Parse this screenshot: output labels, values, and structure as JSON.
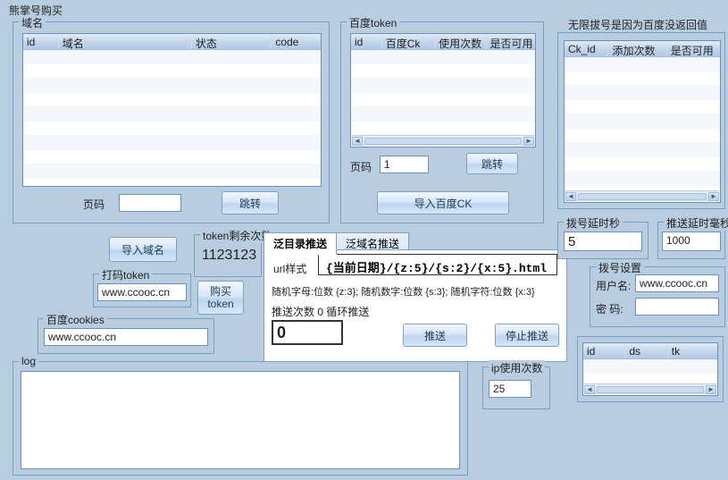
{
  "top_title": "熊掌号购买",
  "domain_group": {
    "label": "域名",
    "cols": {
      "id": "id",
      "name": "域名",
      "status": "状态",
      "code": "code"
    },
    "page_label": "页码",
    "page_value": "",
    "jump_label": "跳转"
  },
  "baidu_group": {
    "label": "百度token",
    "cols": {
      "id": "id",
      "ck": "百度Ck",
      "count": "使用次数",
      "usable": "是否可用"
    },
    "page_label": "页码",
    "page_value": "1",
    "jump_label": "跳转",
    "import_label": "导入百度CK"
  },
  "right_warning": "无限拔号是因为百度没返回值",
  "right_table": {
    "cols": {
      "ckid": "Ck_id",
      "add": "添加次数",
      "usable": "是否可用"
    }
  },
  "import_domain_btn": "导入域名",
  "remaining_token": {
    "label": "token剩余次数",
    "value": "1123123"
  },
  "buy_token_btn": "购买\ntoken",
  "dama_token": {
    "label": "打码token",
    "value": "www.ccooc.cn"
  },
  "baidu_cookies": {
    "label": "百度cookies",
    "value": "www.ccooc.cn"
  },
  "log": {
    "label": "log"
  },
  "delay_sec": {
    "label": "拨号延时秒",
    "value": "5"
  },
  "delay_ms": {
    "label": "推送延时毫秒",
    "value": "1000"
  },
  "dial_settings": {
    "label": "拨号设置",
    "user_label": "用户名:",
    "user_value": "www.ccooc.cn",
    "pass_label": "密 码:",
    "pass_value": ""
  },
  "small_table": {
    "cols": {
      "id": "id",
      "ds": "ds",
      "tk": "tk"
    }
  },
  "ip_usage": {
    "label": "ip使用次数",
    "value": "25"
  },
  "tabs": {
    "tab1": "泛目录推送",
    "tab2": "泛域名推送",
    "url_label": "url样式",
    "url_value": "{当前日期}/{z:5}/{s:2}/{x:5}.html",
    "hint": "随机字母:位数 {z:3}; 随机数字:位数 {s:3}; 随机字符:位数 {x:3}",
    "push_n_label": "推送次数 0 循环推送",
    "push_n_value": "0",
    "push_btn": "推送",
    "stop_btn": "停止推送"
  }
}
